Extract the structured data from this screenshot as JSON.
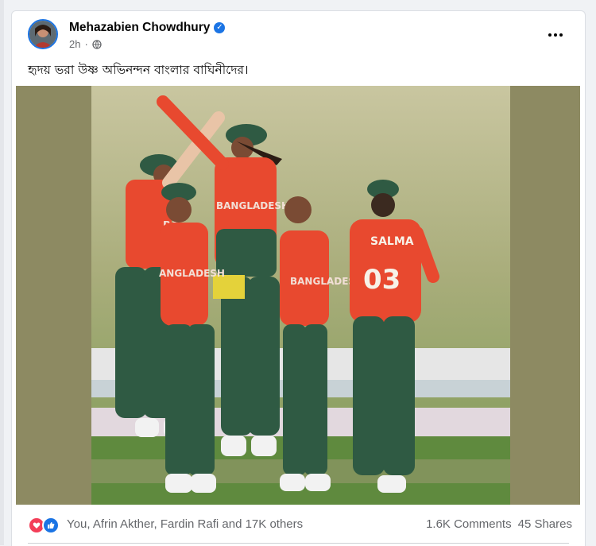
{
  "post": {
    "author": "Mehazabien Chowdhury",
    "time": "2h",
    "caption": "হৃদয় ভরা উষ্ণ অভিনন্দন বাংলার বাঘিনীদের।",
    "icons": {
      "verified": "verified-badge-icon",
      "privacy": "globe-icon",
      "more": "more-options-icon"
    },
    "photo": {
      "jersey_texts": [
        "BA",
        "BANGLADESH",
        "ANGLADESH",
        "BANGLADES",
        "SALMA",
        "03"
      ]
    }
  },
  "engagement": {
    "reaction_icons": [
      "heart-reaction-icon",
      "like-reaction-icon"
    ],
    "reactions_text": "You, Afrin Akther, Fardin Rafi and 17K others",
    "comments": "1.6K Comments",
    "shares": "45 Shares"
  },
  "colors": {
    "accent": "#1b74e4",
    "heart": "#f33e58",
    "jersey_red": "#e8492f",
    "jersey_green": "#2f5a43",
    "photo_side": "#8d8a62"
  }
}
